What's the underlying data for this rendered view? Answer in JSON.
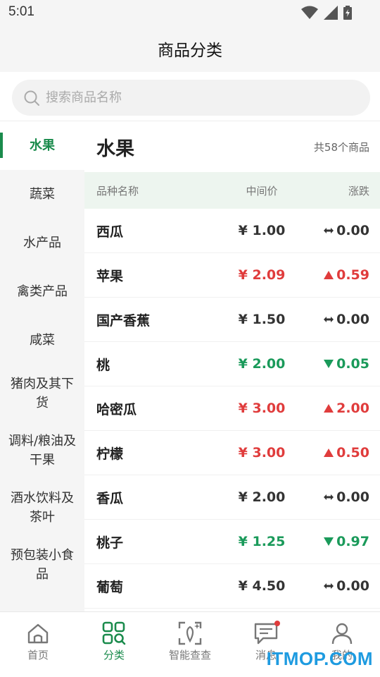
{
  "status": {
    "time": "5:01"
  },
  "header": {
    "title": "商品分类"
  },
  "search": {
    "placeholder": "搜索商品名称"
  },
  "sidebar": {
    "items": [
      {
        "label": "水果",
        "active": true
      },
      {
        "label": "蔬菜"
      },
      {
        "label": "水产品"
      },
      {
        "label": "禽类产品"
      },
      {
        "label": "咸菜"
      },
      {
        "label": "猪肉及其下货"
      },
      {
        "label": "调料/粮油及干果"
      },
      {
        "label": "酒水饮料及茶叶"
      },
      {
        "label": "预包装小食品"
      }
    ]
  },
  "main": {
    "category_title": "水果",
    "count_text": "共58个商品",
    "columns": {
      "name": "品种名称",
      "price": "中间价",
      "change": "涨跌"
    },
    "rows": [
      {
        "name": "西瓜",
        "price": "¥ 1.00",
        "change": "0.00",
        "trend": "flat"
      },
      {
        "name": "苹果",
        "price": "¥ 2.09",
        "change": "0.59",
        "trend": "up"
      },
      {
        "name": "国产香蕉",
        "price": "¥ 1.50",
        "change": "0.00",
        "trend": "flat"
      },
      {
        "name": "桃",
        "price": "¥ 2.00",
        "change": "0.05",
        "trend": "down"
      },
      {
        "name": "哈密瓜",
        "price": "¥ 3.00",
        "change": "2.00",
        "trend": "up"
      },
      {
        "name": "柠檬",
        "price": "¥ 3.00",
        "change": "0.50",
        "trend": "up"
      },
      {
        "name": "香瓜",
        "price": "¥ 2.00",
        "change": "0.00",
        "trend": "flat"
      },
      {
        "name": "桃子",
        "price": "¥ 1.25",
        "change": "0.97",
        "trend": "down"
      },
      {
        "name": "葡萄",
        "price": "¥ 4.50",
        "change": "0.00",
        "trend": "flat"
      }
    ]
  },
  "tabbar": {
    "tabs": [
      {
        "label": "首页",
        "icon": "home-icon"
      },
      {
        "label": "分类",
        "icon": "category-icon",
        "active": true
      },
      {
        "label": "智能查查",
        "icon": "scan-icon"
      },
      {
        "label": "消息",
        "icon": "message-icon"
      },
      {
        "label": "我的",
        "icon": "user-icon"
      }
    ]
  },
  "watermark": "ITMOP.COM",
  "colors": {
    "accent": "#1a8b4c",
    "up": "#e03c3c",
    "down": "#1a9a5a",
    "header_bg": "#edf5ef"
  }
}
